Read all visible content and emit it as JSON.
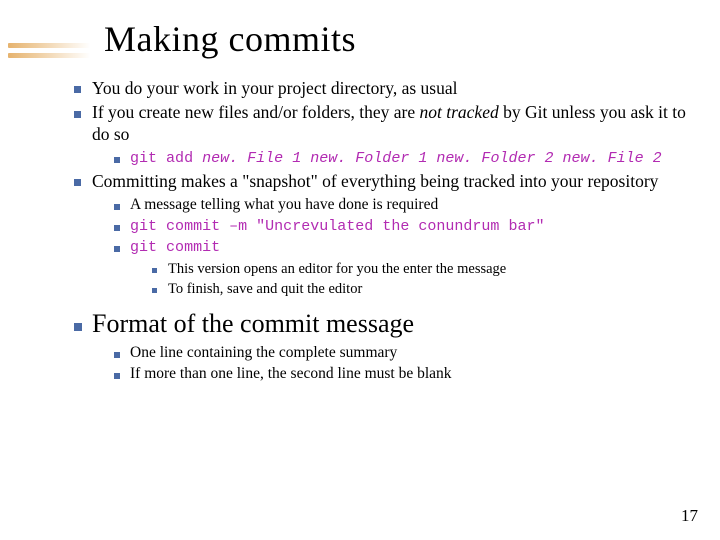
{
  "title": "Making commits",
  "b1": "You do your work in your project directory, as usual",
  "b2_pre": "If you create new files and/or folders, they are ",
  "b2_em": "not tracked",
  "b2_post": " by Git unless you ask it to do so",
  "b2a_cmd": "git add ",
  "b2a_args": "new. File 1 new. Folder 1 new. Folder 2 new. File 2",
  "b3": "Committing makes a \"snapshot\" of everything being tracked into your repository",
  "b3a": "A message telling what you have done is required",
  "b3b": "git commit –m \"Uncrevulated the conundrum bar\"",
  "b3c": "git commit",
  "b3c1": "This version opens an editor for you the enter the message",
  "b3c2": "To finish, save and quit the editor",
  "b4": "Format of the commit message",
  "b4a": "One line containing the complete summary",
  "b4b": "If more than one line, the second line must be blank",
  "pagenum": "17"
}
